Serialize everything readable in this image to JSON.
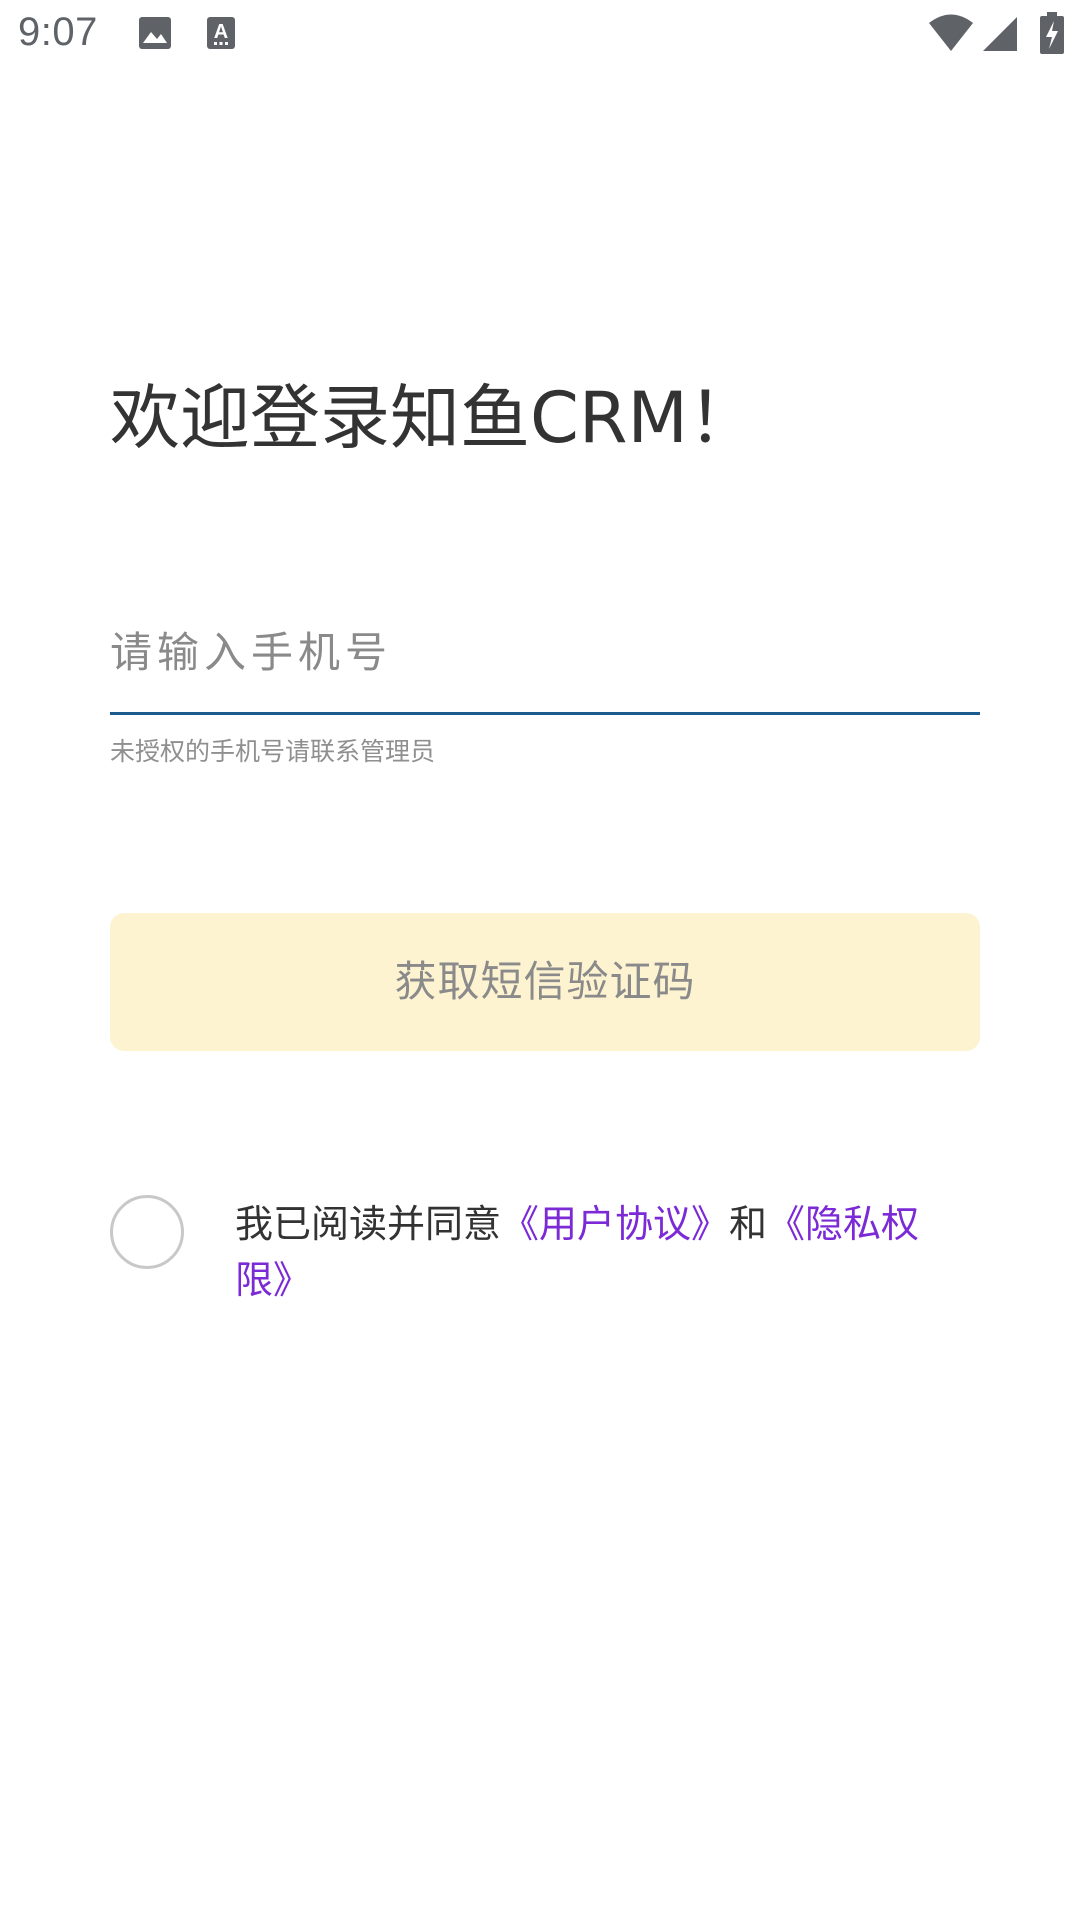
{
  "status_bar": {
    "time": "9:07",
    "icons": [
      "image-icon",
      "text-a-icon",
      "wifi-icon",
      "cell-signal-icon",
      "battery-charging-icon"
    ]
  },
  "login": {
    "title": "欢迎登录知鱼CRM！",
    "phone_placeholder": "请输入手机号",
    "phone_value": "",
    "helper": "未授权的手机号请联系管理员",
    "sms_button_label": "获取短信验证码"
  },
  "agreement": {
    "prefix": "我已阅读并同意",
    "user_agreement": "《用户协议》",
    "conjunction": "和",
    "privacy": "《隐私权限》",
    "checked": false
  },
  "colors": {
    "button_bg": "#fdf3d1",
    "underline": "#1d5a8e",
    "link": "#7b2ad6",
    "title": "#333333"
  }
}
